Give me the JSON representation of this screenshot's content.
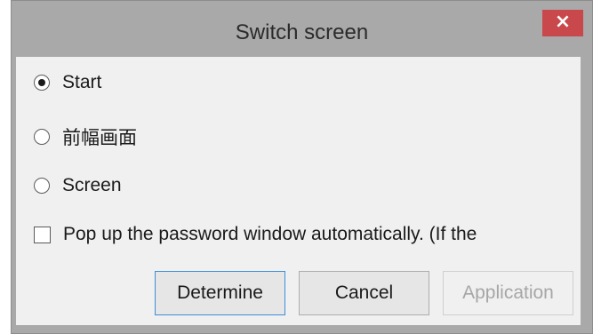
{
  "dialog": {
    "title": "Switch screen",
    "close_label": "×"
  },
  "options": [
    {
      "label": "Start",
      "checked": true
    },
    {
      "label": "前幅画面",
      "checked": false
    },
    {
      "label": "Screen",
      "checked": false
    }
  ],
  "password_popup": {
    "label": "Pop up the password window automatically. (If the",
    "checked": false
  },
  "buttons": {
    "determine": "Determine",
    "cancel": "Cancel",
    "application": "Application"
  },
  "colors": {
    "titlebar": "#a9a9a9",
    "close_button": "#c8484b",
    "client_background": "#f0f0f0",
    "default_button_border": "#3c8fd9"
  },
  "icons": {
    "close": "close-icon"
  }
}
